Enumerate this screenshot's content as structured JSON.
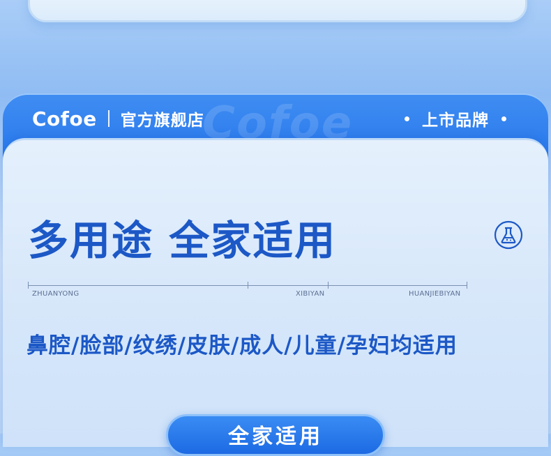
{
  "header": {
    "logo": "Cofoe",
    "store_label": "官方旗舰店",
    "watermark": "Cofoe",
    "tag_label": "上市品牌"
  },
  "main": {
    "headline": "多用途 全家适用",
    "icon": "flask-icon",
    "rule_labels": [
      "ZHUANYONG",
      "XIBIYAN",
      "HUANJIEBIYAN"
    ],
    "subline": "鼻腔/脸部/纹绣/皮肤/成人/儿童/孕妇均适用"
  },
  "cta": {
    "label": "全家适用"
  },
  "colors": {
    "primary": "#1c58c6",
    "band": "#2171ea",
    "background": "#a9cdf7"
  }
}
